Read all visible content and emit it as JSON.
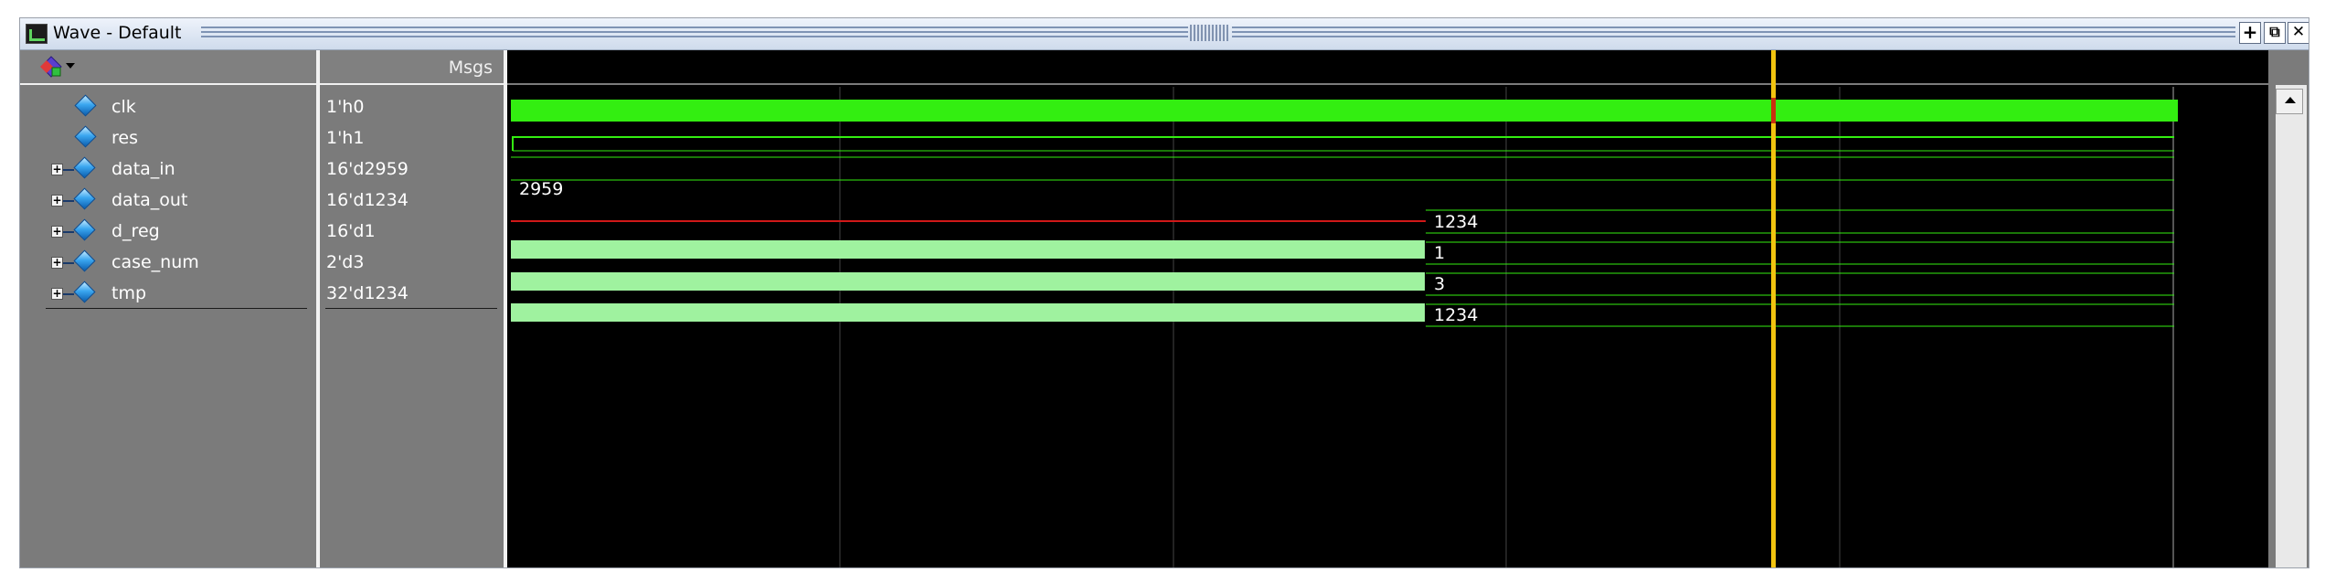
{
  "window": {
    "title": "Wave - Default",
    "buttons": {
      "add": "+",
      "undock": "⧉",
      "close": "✕"
    }
  },
  "columns": {
    "msgs_header": "Msgs"
  },
  "signals": [
    {
      "name": "clk",
      "value": "1'h0",
      "expandable": false
    },
    {
      "name": "res",
      "value": "1'h1",
      "expandable": false
    },
    {
      "name": "data_in",
      "value": "16'd2959",
      "expandable": true
    },
    {
      "name": "data_out",
      "value": "16'd1234",
      "expandable": true
    },
    {
      "name": "d_reg",
      "value": "16'd1",
      "expandable": true
    },
    {
      "name": "case_num",
      "value": "2'd3",
      "expandable": true
    },
    {
      "name": "tmp",
      "value": "32'd1234",
      "expandable": true
    }
  ],
  "waves": {
    "data_in_label": "2959",
    "data_out_label": "1234",
    "d_reg_label": "1",
    "case_num_label": "3",
    "tmp_label": "1234"
  },
  "colors": {
    "clock_wave": "#33ee11",
    "bus_wave": "#9ff29f",
    "undefined_wave": "#d01818",
    "cursor": "#f2c40f",
    "grid": "#444444"
  },
  "icons": [
    "window-app-icon",
    "wave-signal-diamond-icon",
    "expand-plus-icon",
    "scroll-up-arrow-icon"
  ]
}
